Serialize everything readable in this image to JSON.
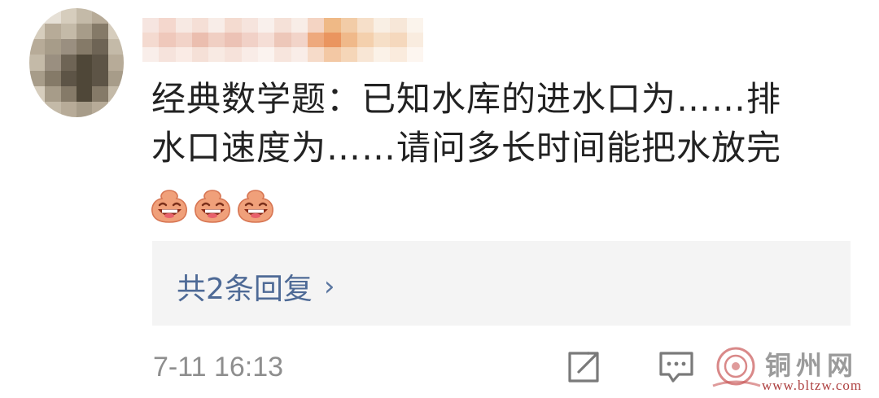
{
  "comment": {
    "line1": "经典数学题：已知水库的进水口为……排",
    "line2": "水口速度为……请问多长时间能把水放完",
    "emoji_count": 3
  },
  "replies": {
    "label": "共2条回复",
    "chevron": "›"
  },
  "meta": {
    "timestamp": "7-11 16:13"
  },
  "icons": {
    "share": "share-icon",
    "comment": "comment-icon",
    "emoji": "laughing-face-emoji"
  },
  "watermark": {
    "title": "铜州网",
    "url": "www.bltzw.com"
  },
  "colors": {
    "link": "#4e6a96",
    "text": "#222222",
    "muted": "#8e8e8e",
    "replies_bg": "#f4f4f4",
    "emoji": "#f0a07a"
  }
}
